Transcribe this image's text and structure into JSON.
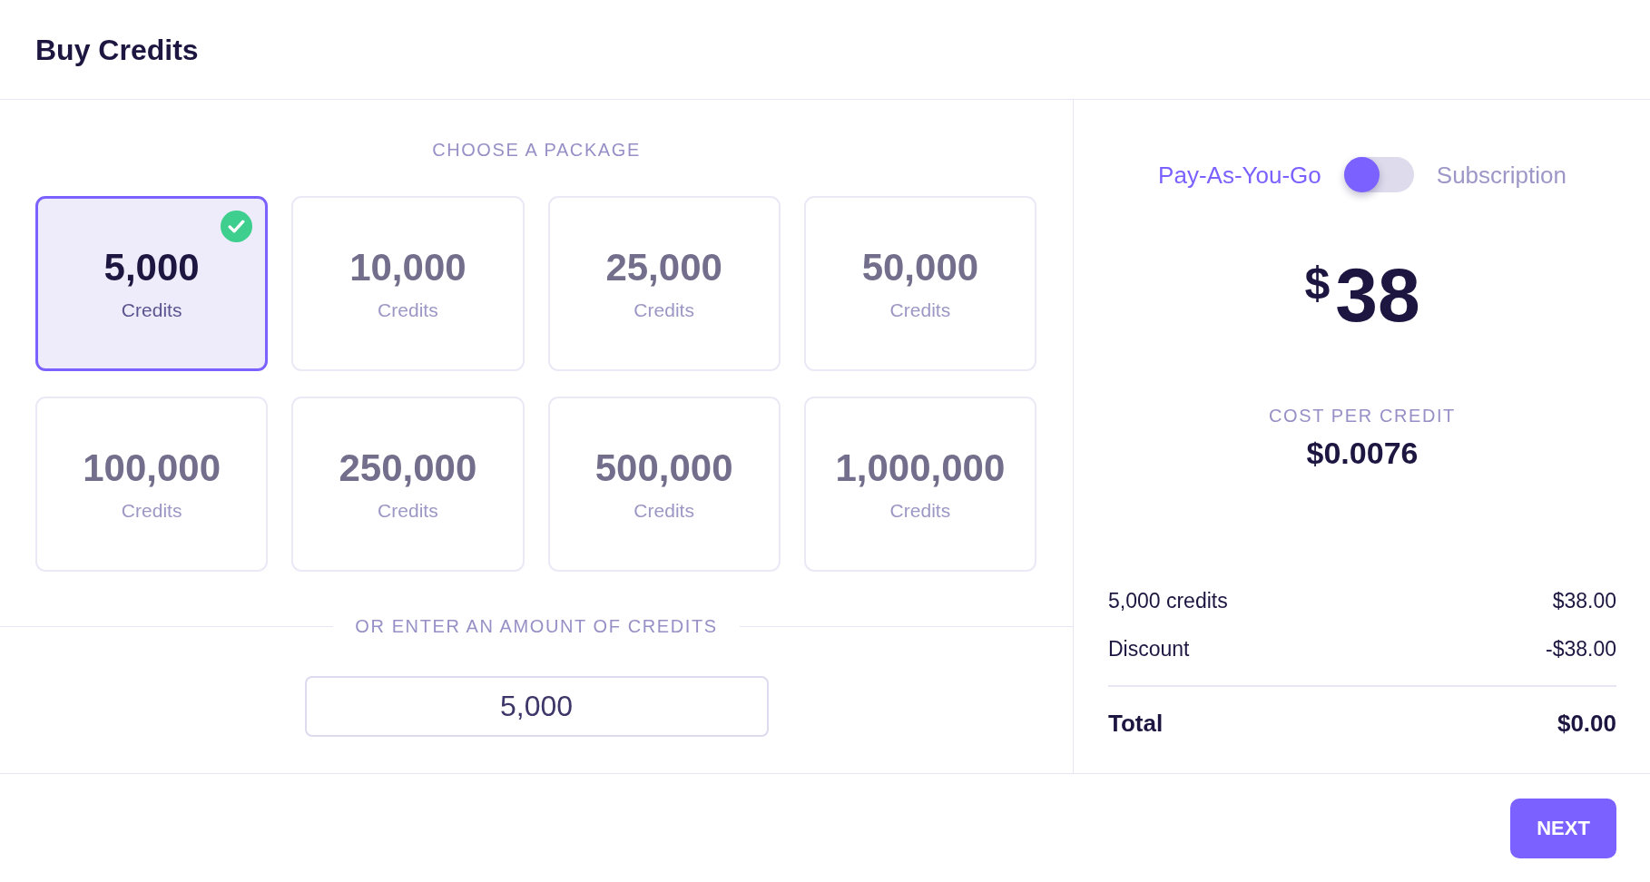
{
  "header": {
    "title": "Buy Credits"
  },
  "packages": {
    "heading": "CHOOSE A PACKAGE",
    "items": [
      {
        "amount": "5,000",
        "unit": "Credits",
        "selected": true
      },
      {
        "amount": "10,000",
        "unit": "Credits",
        "selected": false
      },
      {
        "amount": "25,000",
        "unit": "Credits",
        "selected": false
      },
      {
        "amount": "50,000",
        "unit": "Credits",
        "selected": false
      },
      {
        "amount": "100,000",
        "unit": "Credits",
        "selected": false
      },
      {
        "amount": "250,000",
        "unit": "Credits",
        "selected": false
      },
      {
        "amount": "500,000",
        "unit": "Credits",
        "selected": false
      },
      {
        "amount": "1,000,000",
        "unit": "Credits",
        "selected": false
      }
    ]
  },
  "custom_amount": {
    "label": "OR ENTER AN AMOUNT OF CREDITS",
    "value": "5,000"
  },
  "billing": {
    "left_label": "Pay-As-You-Go",
    "right_label": "Subscription",
    "on": false
  },
  "price": {
    "currency": "$",
    "amount": "38"
  },
  "cost_per_credit": {
    "label": "COST PER CREDIT",
    "value": "$0.0076"
  },
  "summary": {
    "rows": [
      {
        "label": "5,000 credits",
        "value": "$38.00"
      },
      {
        "label": "Discount",
        "value": "-$38.00"
      }
    ],
    "total": {
      "label": "Total",
      "value": "$0.00"
    }
  },
  "footer": {
    "button": "NEXT"
  }
}
